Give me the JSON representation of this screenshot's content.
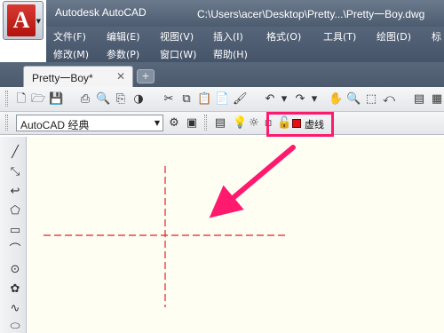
{
  "app": {
    "title": "Autodesk AutoCAD",
    "document_path": "C:\\Users\\acer\\Desktop\\Pretty...\\Pretty一Boy.dwg",
    "logo_letter": "A"
  },
  "menu": {
    "row1": [
      "文件(F)",
      "编辑(E)",
      "视图(V)",
      "插入(I)",
      "格式(O)",
      "工具(T)",
      "绘图(D)",
      "标"
    ],
    "row2": [
      "修改(M)",
      "参数(P)",
      "窗口(W)",
      "帮助(H)"
    ]
  },
  "tabs": {
    "active": "Pretty一Boy*",
    "close_glyph": "✕",
    "new_glyph": "+"
  },
  "workspace": {
    "selected": "AutoCAD 经典"
  },
  "layer": {
    "name": "虚线",
    "color": "#e01010"
  },
  "colors": {
    "annotation_arrow": "#ff1a6e",
    "highlight_box": "#ff1a6e",
    "centerline": "#e0202a",
    "canvas_background": "#fffef3"
  }
}
